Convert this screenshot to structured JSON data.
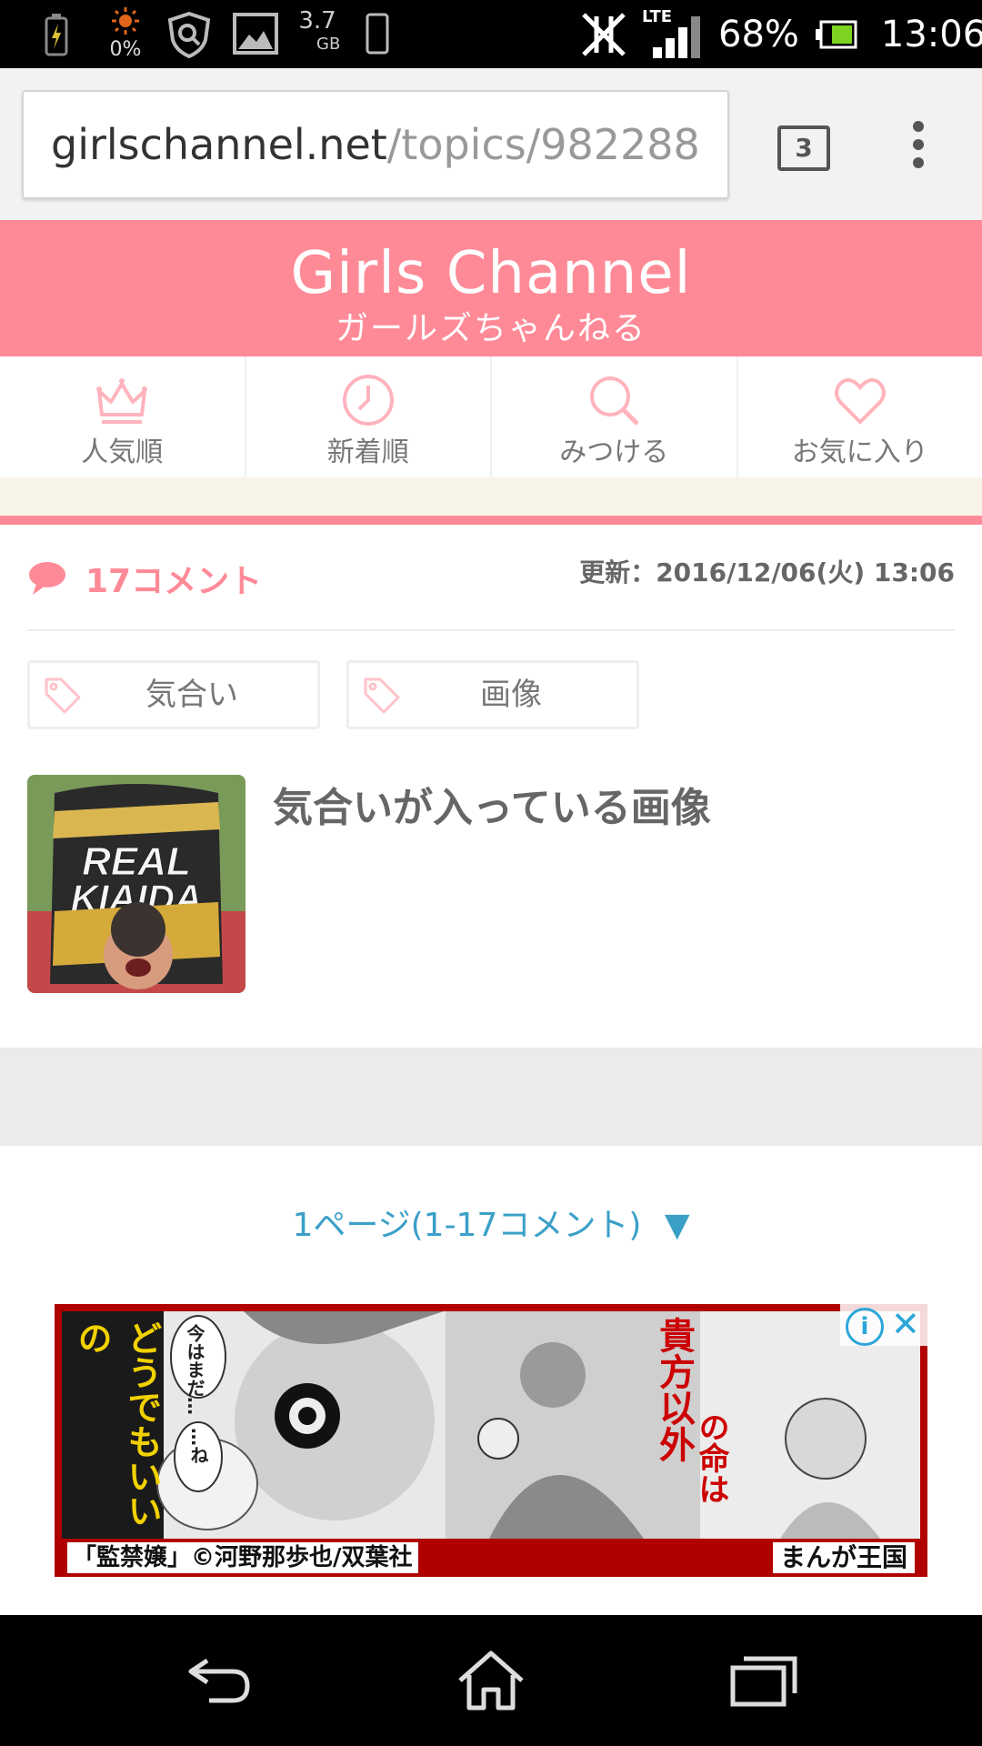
{
  "status_bar": {
    "storage_pct": "0%",
    "storage_size": "3.7",
    "storage_unit": "GB",
    "network": "LTE",
    "battery_pct": "68%",
    "time": "13:06"
  },
  "browser": {
    "url_host": "girlschannel.net",
    "url_path": "/topics/982288",
    "tab_count": "3"
  },
  "site": {
    "logo": "Girls Channel",
    "logo_sub": "ガールズちゃんねる",
    "brand_color": "#ff8a97"
  },
  "nav": [
    {
      "label": "人気順",
      "icon": "crown-icon"
    },
    {
      "label": "新着順",
      "icon": "clock-icon"
    },
    {
      "label": "みつける",
      "icon": "search-icon"
    },
    {
      "label": "お気に入り",
      "icon": "heart-icon"
    }
  ],
  "topic": {
    "comment_count": "17コメント",
    "updated": "更新：2016/12/06(火) 13:06",
    "tags": [
      "気合い",
      "画像"
    ],
    "title": "気合いが入っている画像",
    "thumb_text": "REAL KIAIDA"
  },
  "pagination": {
    "label": "1ページ(1-17コメント)",
    "arrow": "▼"
  },
  "ad": {
    "left_vertical": "どうでもいいの",
    "bubble1": "今はまだ…",
    "bubble2": "…ね",
    "right_vertical_1": "貴方以外",
    "right_vertical_2": "の命は",
    "caption": "「監禁嬢」©河野那歩也/双葉社",
    "brand": "まんが王国",
    "info": "i",
    "close": "✕"
  }
}
